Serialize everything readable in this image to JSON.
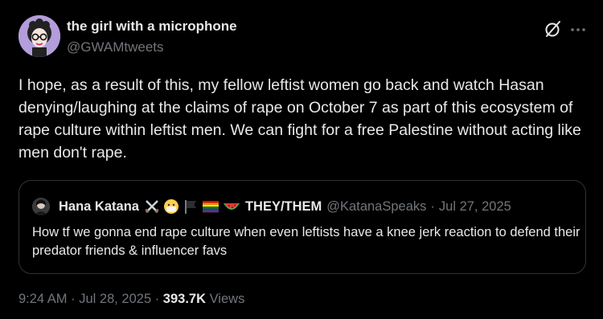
{
  "author": {
    "display_name": "the girl with a microphone",
    "handle": "@GWAMtweets"
  },
  "tweet": {
    "text": "I hope, as a result of this, my fellow leftist women go back and watch Hasan denying/laughing at the claims of rape on October 7 as part of this ecosystem of rape culture within leftist men. We can fight for a free Palestine without acting like men don't rape."
  },
  "quote": {
    "display_name": "Hana Katana",
    "emojis": [
      "crossed-swords",
      "face-with-medical-mask",
      "black-flag",
      "rainbow-flag",
      "watermelon"
    ],
    "name_suffix": "THEY/THEM",
    "handle": "@KatanaSpeaks",
    "separator": "·",
    "date": "Jul 27, 2025",
    "text": "How tf we gonna end rape culture when even leftists have a knee jerk reaction to defend their predator friends & influencer favs"
  },
  "meta": {
    "time": "9:24 AM",
    "sep1": " · ",
    "date": "Jul 28, 2025",
    "sep2": " · ",
    "views_count": "393.7K",
    "views_label": " Views"
  },
  "icons": {
    "header_right": [
      "grok-icon",
      "more-icon"
    ]
  },
  "colors": {
    "background": "#000000",
    "text_primary": "#e7e9ea",
    "text_secondary": "#71767b",
    "border": "#2f3336"
  }
}
